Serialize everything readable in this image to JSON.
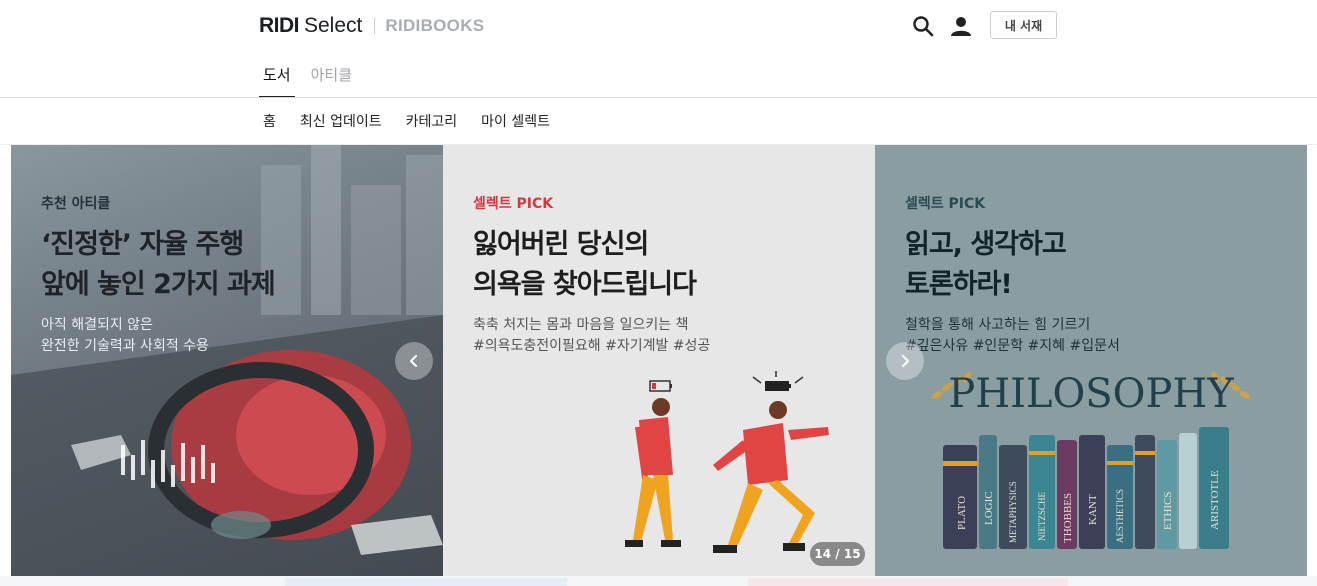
{
  "header": {
    "logo_ridi": "RIDI",
    "logo_select": "Select",
    "logo_books": "RIDIBOOKS",
    "my_library_label": "내 서재",
    "icons": {
      "search": "search-icon",
      "user": "user-icon"
    }
  },
  "tabs": [
    {
      "label": "도서",
      "active": true
    },
    {
      "label": "아티클",
      "active": false
    }
  ],
  "subnav": [
    {
      "label": "홈"
    },
    {
      "label": "최신 업데이트"
    },
    {
      "label": "카테고리"
    },
    {
      "label": "마이 셀렉트"
    }
  ],
  "carousel": {
    "counter": "14 / 15",
    "slides": [
      {
        "eyebrow": "추천 아티클",
        "headline_1": "‘진정한’ 자율 주행",
        "headline_2": "앞에 놓인 2가지 과제",
        "desc_1": "아직 해결되지 않은",
        "desc_2": "완전한 기술력과 사회적 수용"
      },
      {
        "eyebrow": "셀렉트 PICK",
        "headline_1": "잃어버린 당신의",
        "headline_2": "의욕을 찾아드립니다",
        "desc_1": "축축 처지는 몸과 마음을 일으키는 책",
        "desc_2": "#의욕도충전이필요해 #자기계발 #성공"
      },
      {
        "eyebrow": "셀렉트 PICK",
        "headline_1": "읽고, 생각하고",
        "headline_2": "토론하라!",
        "desc_1": "철학을 통해 사고하는 힘 기르기",
        "desc_2": "#깊은사유 #인문학 #지혜 #입문서",
        "art_title": "PHILOSOPHY",
        "book_spines": [
          "PLATO",
          "LOGIC",
          "METAPHYSICS",
          "NIETZSCHE",
          "THOBBES",
          "KANT",
          "AESTHETICS",
          "ETHICS",
          "ARISTOTLE"
        ]
      }
    ]
  },
  "colors": {
    "accent_red": "#d3383d",
    "slide3_bg": "#8a9da1",
    "slide2_bg": "#e7e7e7"
  }
}
